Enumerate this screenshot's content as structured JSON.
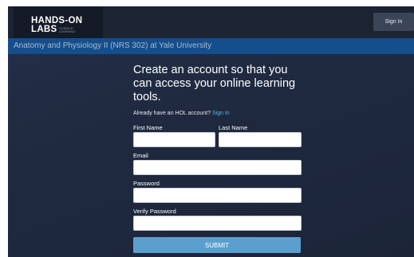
{
  "header": {
    "logo_line1": "HANDS-ON",
    "logo_line2": "LABS",
    "logo_sub": "SCIENCE LEARNING",
    "signin_label": "Sign In"
  },
  "course_bar": {
    "text": "Anatomy and Physiology II (NRS 302) at Yale University"
  },
  "form": {
    "heading": "Create an account so that you can access your online learning tools.",
    "already_text": "Already have an HOL account?",
    "already_link": "Sign In",
    "first_name_label": "First Name",
    "last_name_label": "Last Name",
    "email_label": "Email",
    "password_label": "Password",
    "verify_password_label": "Verify Password",
    "submit_label": "SUBMIT",
    "first_name_value": "",
    "last_name_value": "",
    "email_value": "",
    "password_value": "",
    "verify_password_value": ""
  },
  "colors": {
    "course_bar": "#154e8c",
    "link": "#5ab3ec",
    "submit": "#5b9fcf",
    "background": "#1f2a40"
  }
}
